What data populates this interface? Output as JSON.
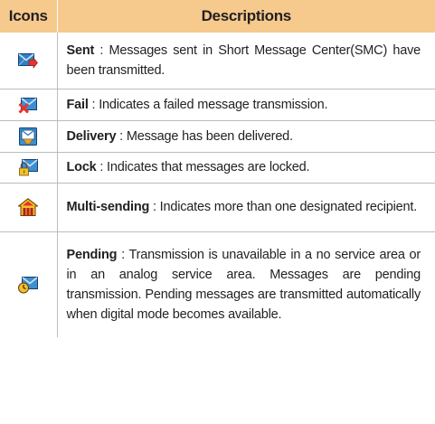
{
  "headers": {
    "icons": "Icons",
    "descriptions": "Descriptions"
  },
  "rows": [
    {
      "icon": "envelope-sent-icon",
      "term": "Sent",
      "separator": " : ",
      "text": "Messages sent in Short Message Center(SMC) have been transmitted."
    },
    {
      "icon": "envelope-fail-icon",
      "term": "Fail",
      "separator": " : ",
      "text": "Indicates a failed message transmission."
    },
    {
      "icon": "envelope-delivery-icon",
      "term": "Delivery",
      "separator": " : ",
      "text": "Message has been delivered."
    },
    {
      "icon": "envelope-lock-icon",
      "term": "Lock",
      "separator": " : ",
      "text": "Indicates that messages are locked."
    },
    {
      "icon": "multi-sending-house-icon",
      "term": "Multi-sending",
      "separator": " : ",
      "text": "Indicates more than one designated recipient."
    },
    {
      "icon": "envelope-pending-clock-icon",
      "term": "Pending",
      "separator": " : ",
      "text": "Transmission is unavailable in a no service area or in an analog service area. Messages are pending transmission. Pending messages are transmitted automatically when digital mode becomes available."
    }
  ],
  "colors": {
    "header_background": "#f6c98d",
    "grid_line": "#bcbcbc",
    "text": "#231f20"
  }
}
